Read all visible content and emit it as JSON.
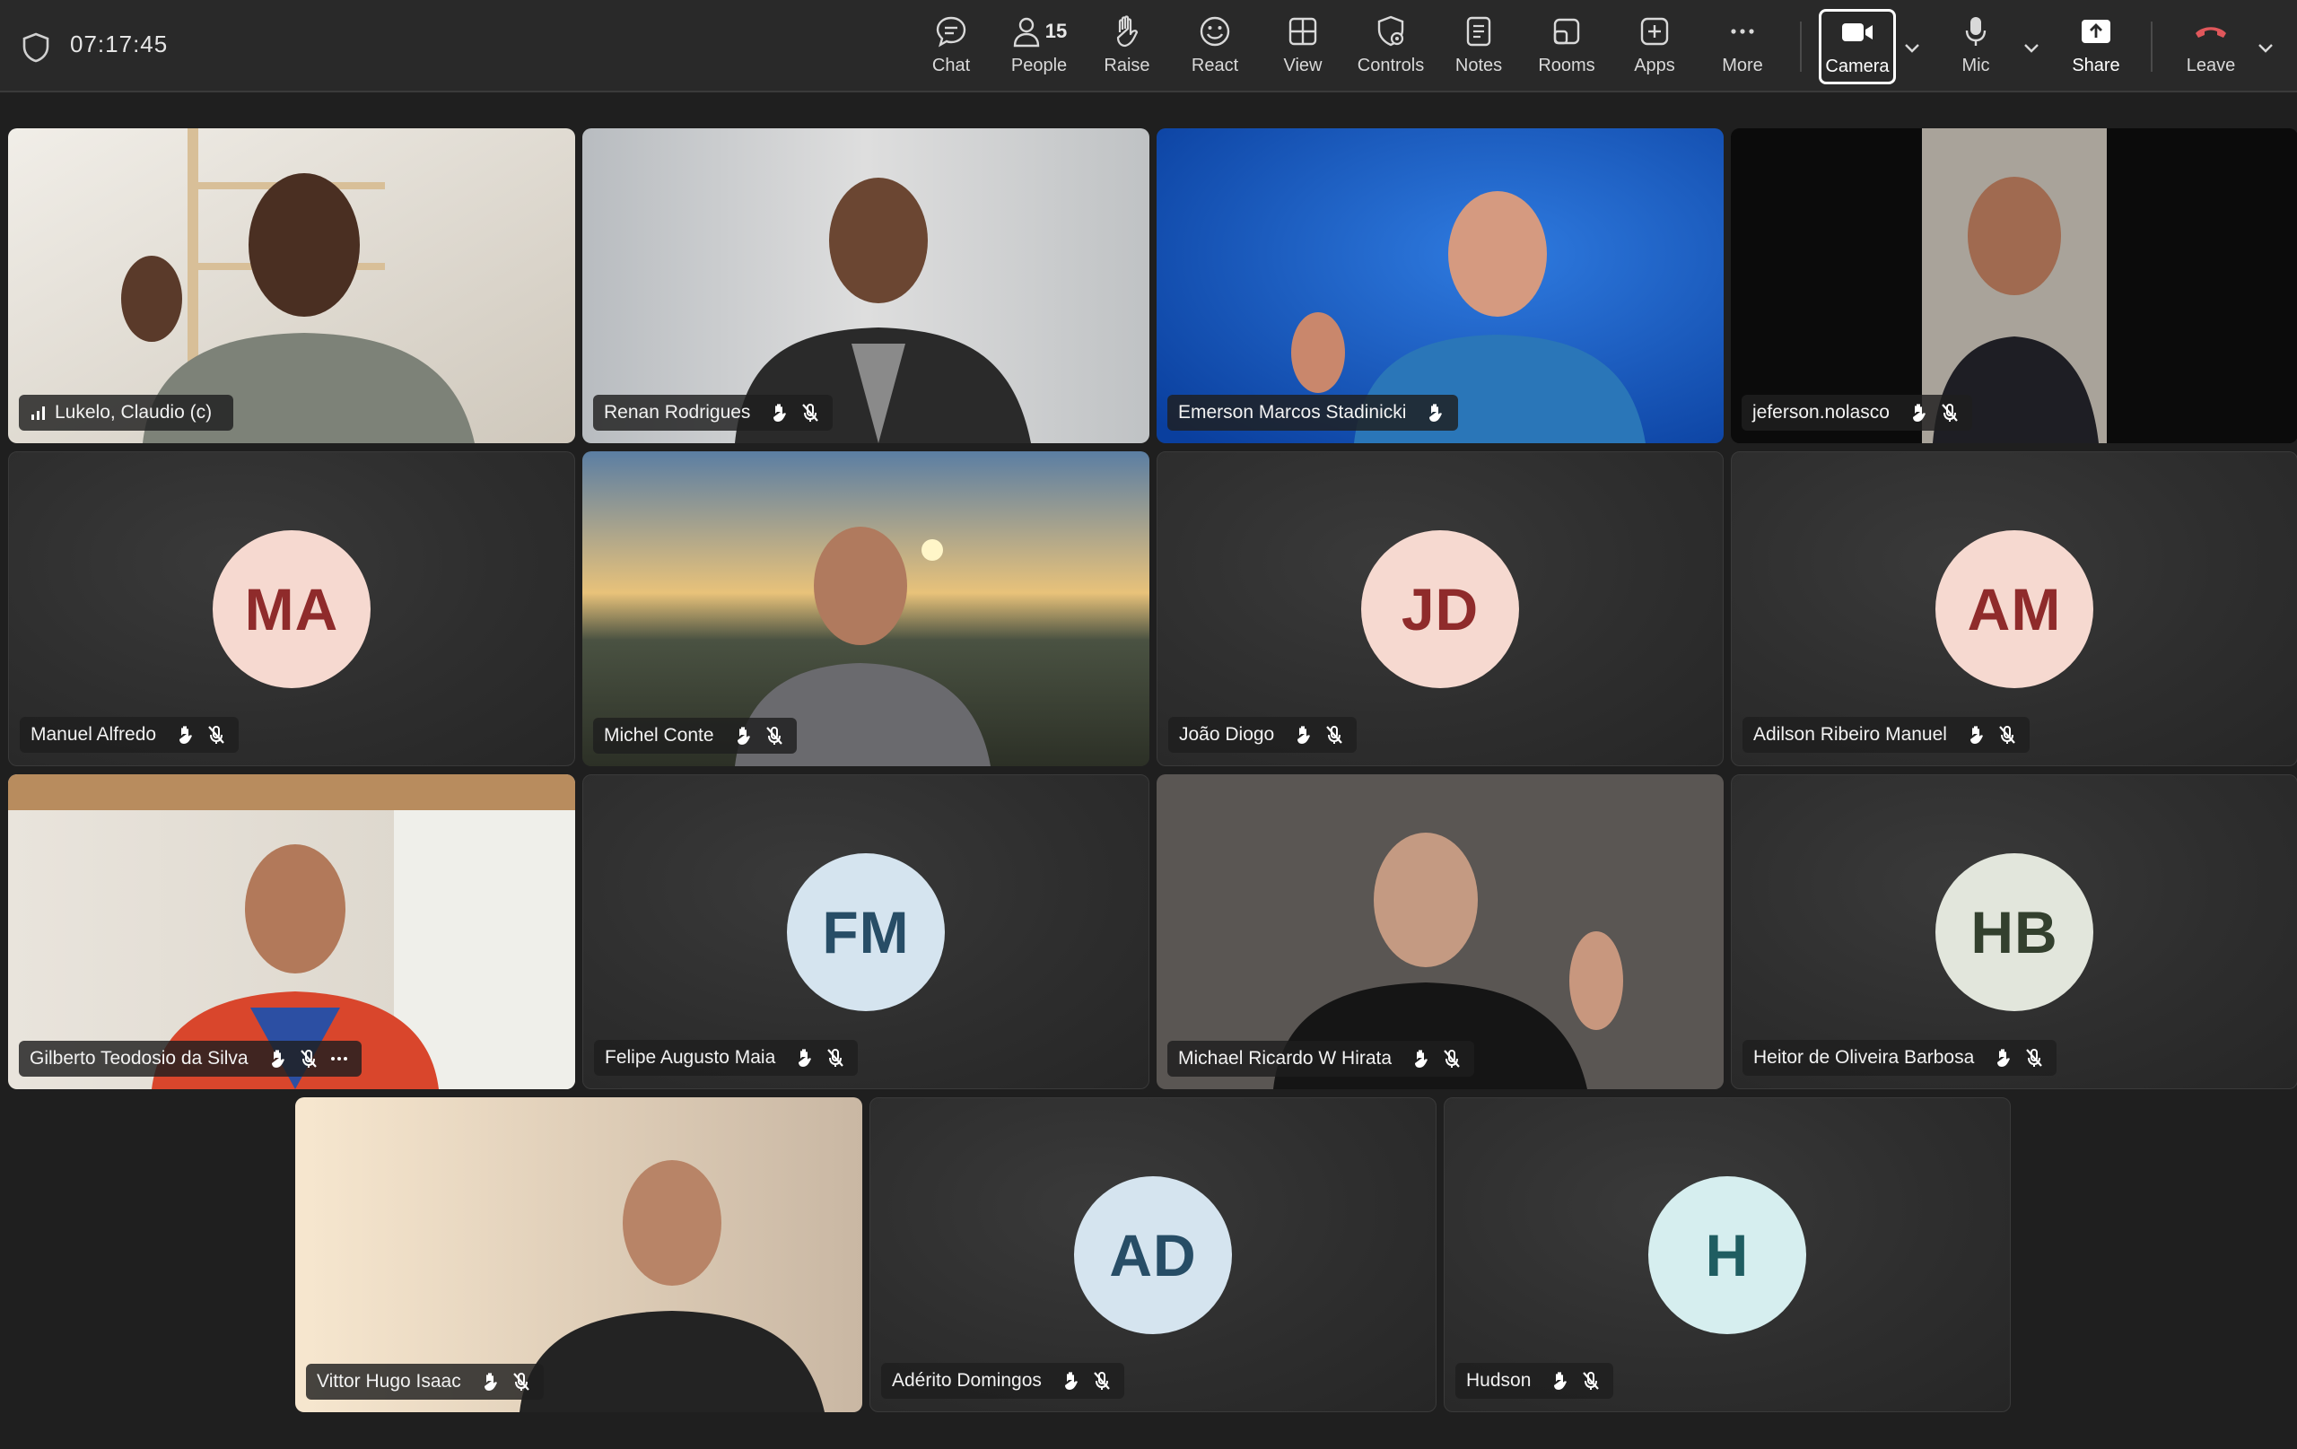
{
  "meeting": {
    "timer": "07:17:45"
  },
  "toolbar": {
    "chat": "Chat",
    "people": "People",
    "people_count": "15",
    "raise": "Raise",
    "react": "React",
    "view": "View",
    "controls": "Controls",
    "notes": "Notes",
    "rooms": "Rooms",
    "apps": "Apps",
    "more": "More",
    "camera": "Camera",
    "mic": "Mic",
    "share": "Share",
    "leave": "Leave"
  },
  "colors": {
    "leave_red": "#e0575b",
    "avatar_pink_bg": "#f6d9d0",
    "avatar_pink_fg": "#8f2b2b",
    "avatar_blue_bg": "#d5e4ef",
    "avatar_blue_fg": "#274d66",
    "avatar_sage_bg": "#e2e6dc",
    "avatar_sage_fg": "#33402e",
    "avatar_teal_bg": "#d6eeef",
    "avatar_teal_fg": "#1f5d61"
  },
  "participants": [
    {
      "name": "Lukelo, Claudio (c)",
      "video": true,
      "icons": [
        "signal-icon"
      ]
    },
    {
      "name": "Renan Rodrigues",
      "video": true,
      "icons": [
        "hand-wave-icon",
        "mic-muted-icon"
      ]
    },
    {
      "name": "Emerson Marcos Stadinicki",
      "video": true,
      "icons": [
        "hand-wave-icon"
      ]
    },
    {
      "name": "jeferson.nolasco",
      "video": true,
      "icons": [
        "hand-wave-icon",
        "mic-muted-icon"
      ]
    },
    {
      "name": "Manuel Alfredo",
      "initials": "MA",
      "video": false,
      "icons": [
        "hand-wave-icon",
        "mic-muted-icon"
      ]
    },
    {
      "name": "Michel Conte",
      "video": true,
      "icons": [
        "hand-wave-icon",
        "mic-muted-icon"
      ]
    },
    {
      "name": "João Diogo",
      "initials": "JD",
      "video": false,
      "icons": [
        "hand-wave-icon",
        "mic-muted-icon"
      ]
    },
    {
      "name": "Adilson Ribeiro Manuel",
      "initials": "AM",
      "video": false,
      "icons": [
        "hand-wave-icon",
        "mic-muted-icon"
      ]
    },
    {
      "name": "Gilberto Teodosio da Silva",
      "video": true,
      "icons": [
        "hand-wave-icon",
        "mic-muted-icon",
        "more-icon"
      ]
    },
    {
      "name": "Felipe Augusto Maia",
      "initials": "FM",
      "video": false,
      "icons": [
        "hand-wave-icon",
        "mic-muted-icon"
      ]
    },
    {
      "name": "Michael Ricardo W Hirata",
      "video": true,
      "icons": [
        "hand-wave-icon",
        "mic-muted-icon"
      ]
    },
    {
      "name": "Heitor de Oliveira Barbosa",
      "initials": "HB",
      "video": false,
      "icons": [
        "hand-wave-icon",
        "mic-muted-icon"
      ]
    },
    {
      "name": "Vittor Hugo Isaac",
      "video": true,
      "icons": [
        "hand-wave-icon",
        "mic-muted-icon"
      ]
    },
    {
      "name": "Adérito Domingos",
      "initials": "AD",
      "video": false,
      "icons": [
        "hand-wave-icon",
        "mic-muted-icon"
      ]
    },
    {
      "name": "Hudson",
      "initials": "H",
      "video": false,
      "icons": [
        "hand-wave-icon",
        "mic-muted-icon"
      ]
    }
  ]
}
